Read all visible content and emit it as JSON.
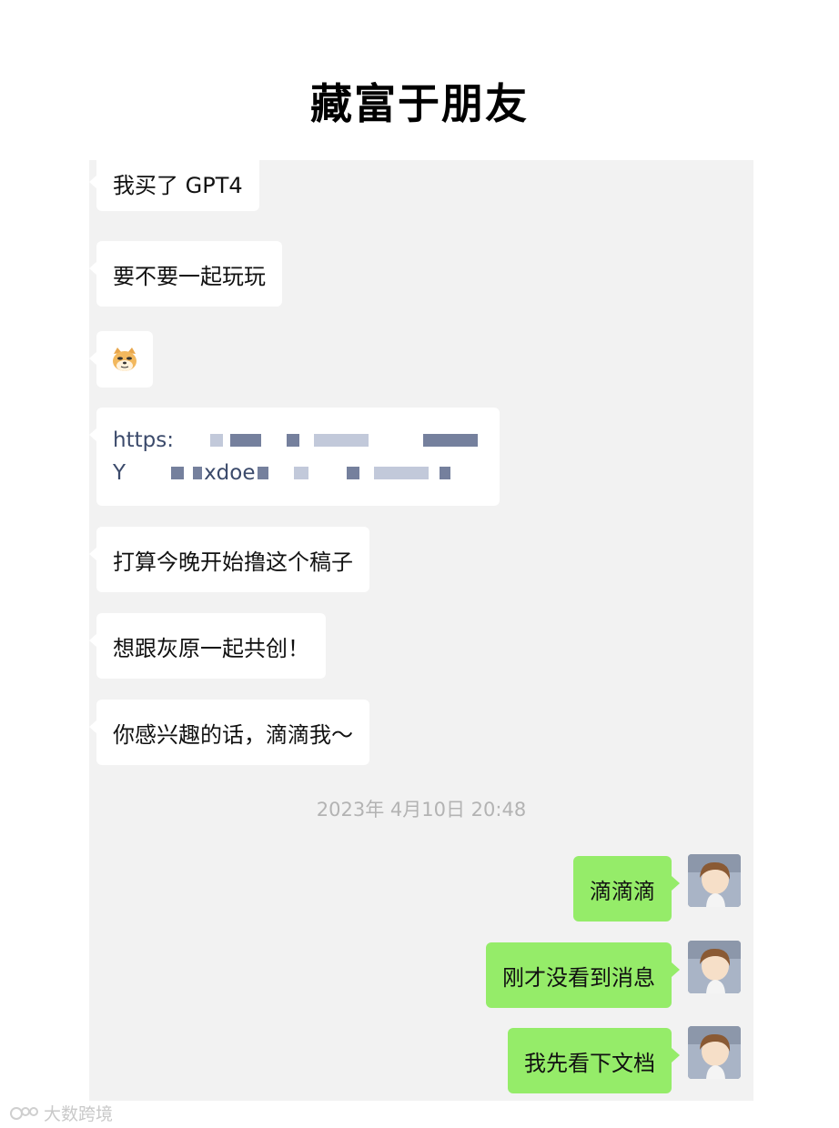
{
  "title": "藏富于朋友",
  "incoming": [
    {
      "text": "我买了 GPT4"
    },
    {
      "text": "要不要一起玩玩"
    },
    {
      "emoji": "doge-icon"
    },
    {
      "link_line1": "https:",
      "link_line2_a": "Y",
      "link_line2_b": "xdoe"
    },
    {
      "text": "打算今晚开始撸这个稿子"
    },
    {
      "text": "想跟灰原一起共创！"
    },
    {
      "text": "你感兴趣的话，滴滴我～"
    }
  ],
  "timestamp": "2023年 4月10日 20:48",
  "outgoing": [
    {
      "text": "滴滴滴"
    },
    {
      "text": "刚才没看到消息"
    },
    {
      "text": "我先看下文档"
    }
  ],
  "watermark": "大数跨境",
  "colors": {
    "chat_bg": "#f2f2f2",
    "incoming": "#ffffff",
    "outgoing": "#95ec69"
  }
}
